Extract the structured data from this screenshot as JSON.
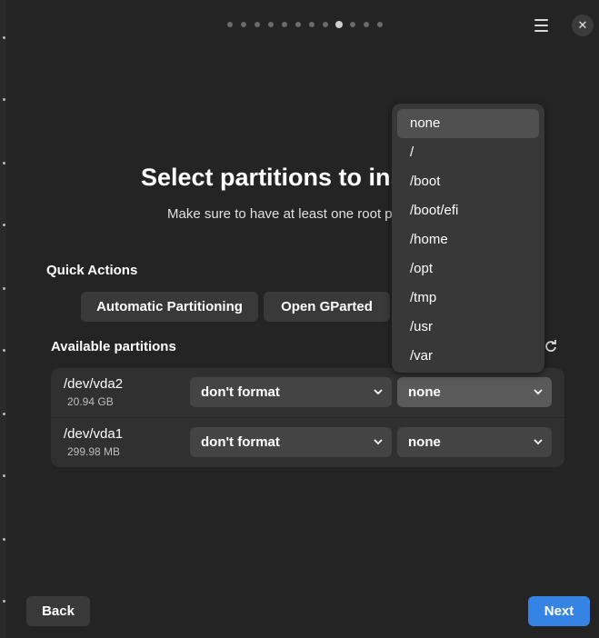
{
  "window": {
    "close_icon": "close-icon",
    "menu_icon": "hamburger-menu-icon"
  },
  "progress": {
    "total_steps": 12,
    "current_step": 9
  },
  "page": {
    "title": "Select partitions to ins",
    "subtitle": "Make sure to have at least one root p"
  },
  "quick_actions": {
    "heading": "Quick Actions",
    "automatic_label": "Automatic Partitioning",
    "gparted_label": "Open GParted"
  },
  "partitions": {
    "heading": "Available partitions",
    "refresh_icon": "refresh-icon",
    "rows": [
      {
        "device": "/dev/vda2",
        "size": "20.94 GB",
        "format": "don't format",
        "mount": "none"
      },
      {
        "device": "/dev/vda1",
        "size": "299.98 MB",
        "format": "don't format",
        "mount": "none"
      }
    ]
  },
  "mount_dropdown": {
    "options": [
      "none",
      "/",
      "/boot",
      "/boot/efi",
      "/home",
      "/opt",
      "/tmp",
      "/usr",
      "/var"
    ],
    "selected": "none"
  },
  "footer": {
    "back_label": "Back",
    "next_label": "Next"
  },
  "colors": {
    "accent": "#3584e4",
    "window_bg": "#242424",
    "card_bg": "#303030"
  }
}
